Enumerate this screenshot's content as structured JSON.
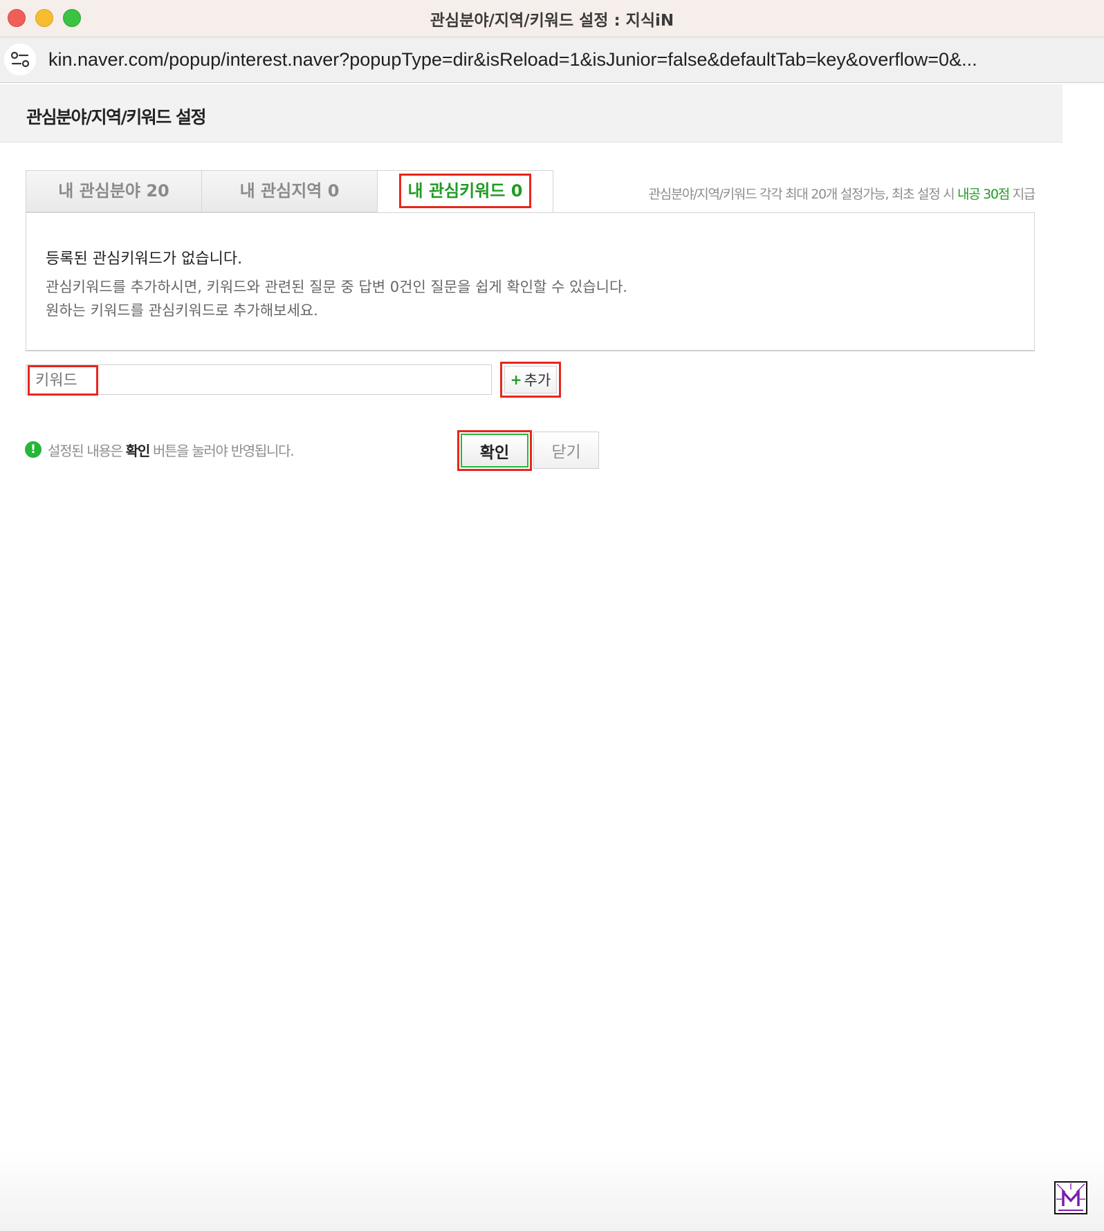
{
  "window": {
    "title": "관심분야/지역/키워드 설정 : 지식iN"
  },
  "address_bar": {
    "url": "kin.naver.com/popup/interest.naver?popupType=dir&isReload=1&isJunior=false&defaultTab=key&overflow=0&..."
  },
  "page": {
    "title": "관심분야/지역/키워드 설정"
  },
  "tabs": [
    {
      "label": "내 관심분야 20",
      "active": false
    },
    {
      "label": "내 관심지역 0",
      "active": false
    },
    {
      "label": "내 관심키워드 0",
      "active": true
    }
  ],
  "tab_note": {
    "prefix": "관심분야/지역/키워드 각각 최대 20개 설정가능, 최초 설정 시 ",
    "highlight": "내공 30점",
    "suffix": " 지급"
  },
  "keyword_panel": {
    "empty_title": "등록된 관심키워드가 없습니다.",
    "desc_line1": "관심키워드를 추가하시면, 키워드와 관련된 질문 중 답변 0건인 질문을 쉽게 확인할 수 있습니다.",
    "desc_line2": "원하는 키워드를 관심키워드로 추가해보세요."
  },
  "keyword_form": {
    "placeholder": "키워드",
    "value": "",
    "add_plus": "+",
    "add_label": "추가"
  },
  "notice": {
    "icon_glyph": "!",
    "prefix": "설정된 내용은 ",
    "bold": "확인",
    "suffix": " 버튼을 눌러야 반영됩니다."
  },
  "actions": {
    "confirm_label": "확인",
    "close_label": "닫기"
  },
  "colors": {
    "accent_green": "#1f9b22",
    "highlight_red": "#e8261c"
  },
  "icons": {
    "site_info": "site-settings-icon",
    "notice": "exclamation-icon",
    "watermark": "m-logo-icon"
  }
}
